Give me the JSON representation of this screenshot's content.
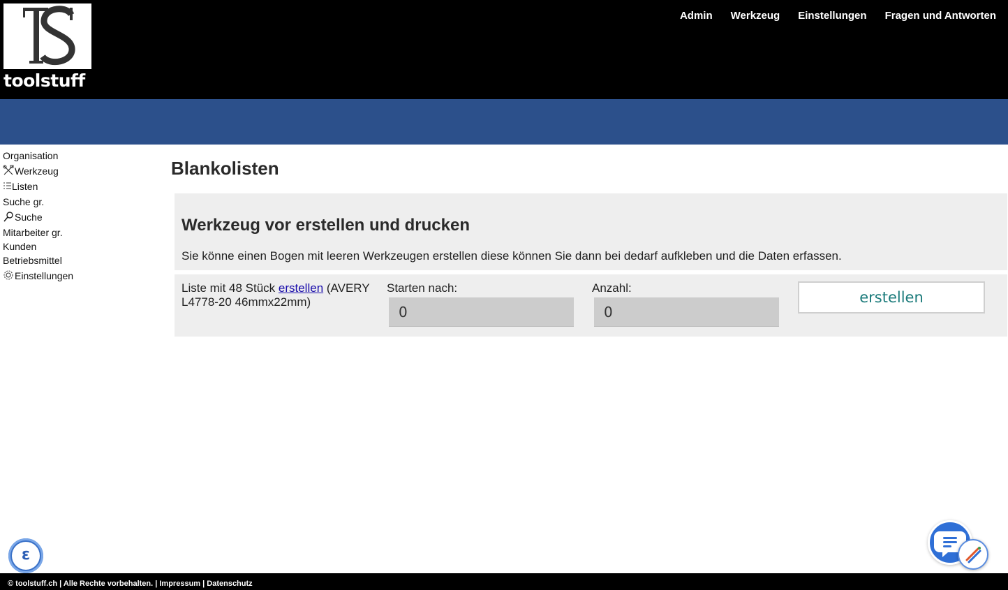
{
  "brand": {
    "logo_letters": "TS",
    "wordmark": "toolstuff"
  },
  "topnav": [
    "Admin",
    "Werkzeug",
    "Einstellungen",
    "Fragen und Antworten"
  ],
  "sidebar": {
    "items": [
      {
        "label": "Organisation",
        "icon": ""
      },
      {
        "label": "Werkzeug",
        "icon": "tools-icon"
      },
      {
        "label": "Listen",
        "icon": "list-icon"
      },
      {
        "label": "Suche gr.",
        "icon": ""
      },
      {
        "label": "Suche",
        "icon": "search-icon"
      },
      {
        "label": "Mitarbeiter gr.",
        "icon": ""
      },
      {
        "label": "Kunden",
        "icon": ""
      },
      {
        "label": "Betriebsmittel",
        "icon": ""
      },
      {
        "label": "Einstellungen",
        "icon": "gear-icon"
      }
    ]
  },
  "main": {
    "title": "Blankolisten",
    "panel": {
      "heading": "Werkzeug vor erstellen und drucken",
      "text": "Sie könne einen Bogen mit leeren Werkzeugen erstellen diese können Sie dann bei dedarf aufkleben und die Daten erfassen."
    },
    "form": {
      "desc_prefix": "Liste mit 48 Stück ",
      "desc_link": "erstellen",
      "desc_suffix": " (AVERY L4778-20 46mmx22mm)",
      "start_label": "Starten nach:",
      "start_value": "0",
      "count_label": "Anzahl:",
      "count_value": "0",
      "submit_label": "erstellen"
    }
  },
  "widgets": {
    "left_badge": "ε"
  },
  "footer": {
    "text": "© toolstuff.ch | Alle Rechte vorbehalten. | Impressum | Datenschutz"
  },
  "colors": {
    "header": "#000000",
    "band": "#2c508b",
    "panel": "#eeeeee",
    "input": "#cccccc",
    "button_text": "#1a7a7a",
    "link": "#1a0dab"
  }
}
